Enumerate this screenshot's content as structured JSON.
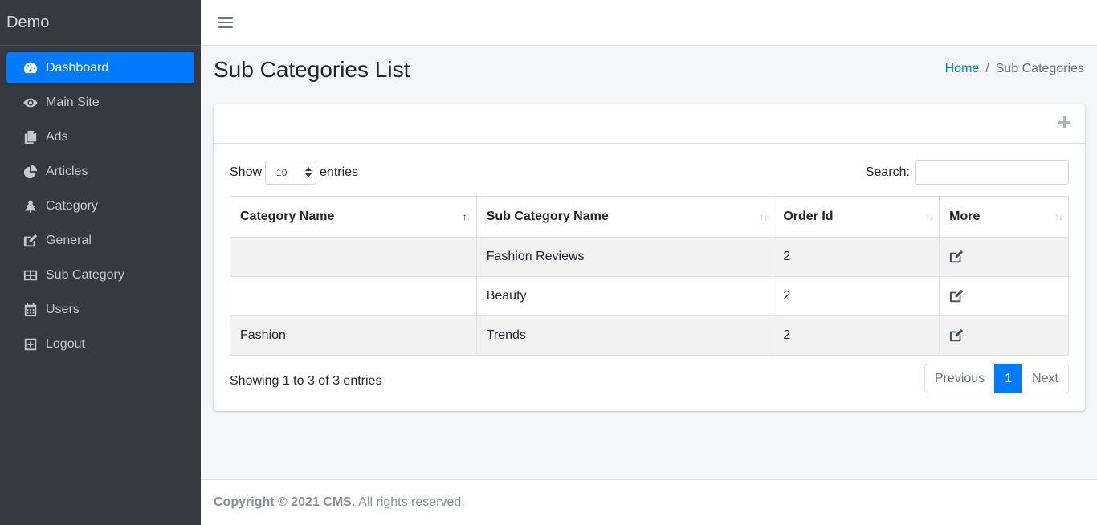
{
  "brand": "Demo",
  "sidebar": {
    "items": [
      {
        "label": "Dashboard",
        "icon": "tachometer-icon",
        "active": true
      },
      {
        "label": "Main Site",
        "icon": "eye-icon"
      },
      {
        "label": "Ads",
        "icon": "copy-icon"
      },
      {
        "label": "Articles",
        "icon": "chart-pie-icon"
      },
      {
        "label": "Category",
        "icon": "tree-icon"
      },
      {
        "label": "General",
        "icon": "edit-icon"
      },
      {
        "label": "Sub Category",
        "icon": "th-large-icon"
      },
      {
        "label": "Users",
        "icon": "calendar-icon"
      },
      {
        "label": "Logout",
        "icon": "plus-square-icon"
      }
    ]
  },
  "header": {
    "toggle_icon": "bars-icon"
  },
  "page": {
    "title": "Sub Categories List",
    "breadcrumb": {
      "home": "Home",
      "separator": "/",
      "current": "Sub Categories"
    }
  },
  "card": {
    "add_icon": "plus-icon",
    "length": {
      "prefix": "Show",
      "selected": "10",
      "suffix": "entries"
    },
    "search": {
      "label": "Search:",
      "value": ""
    },
    "table": {
      "columns": [
        "Category Name",
        "Sub Category Name",
        "Order Id",
        "More"
      ],
      "rows": [
        {
          "category": "",
          "sub_category": "Fashion Reviews",
          "order_id": "2"
        },
        {
          "category": "",
          "sub_category": "Beauty",
          "order_id": "2"
        },
        {
          "category": "Fashion",
          "sub_category": "Trends",
          "order_id": "2"
        }
      ]
    },
    "info": "Showing 1 to 3 of 3 entries",
    "pagination": {
      "previous": "Previous",
      "current": "1",
      "next": "Next"
    }
  },
  "footer": {
    "copyright": "Copyright © 2021 CMS.",
    "rights": "All rights reserved."
  },
  "colors": {
    "sidebar_bg": "#343a40",
    "accent": "#007bff",
    "page_bg": "#f4f6f9"
  }
}
